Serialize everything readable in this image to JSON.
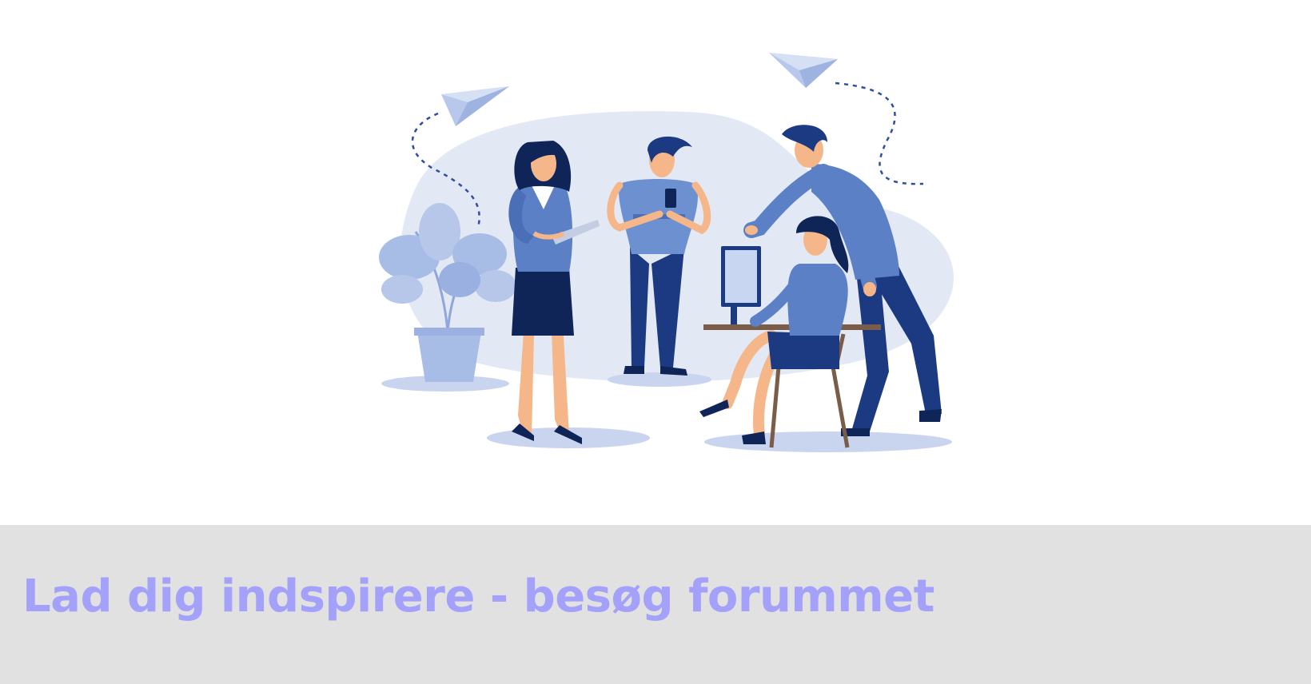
{
  "banner": {
    "link_text": "Lad dig indspirere - besøg forummet"
  },
  "illustration": {
    "icon": "team-office-illustration"
  },
  "colors": {
    "banner_bg": "#e1e1e1",
    "link_text": "#a4a1fb",
    "blob": "#e3e8f5",
    "figure_dark": "#1c3a82",
    "figure_mid": "#5b80c6",
    "figure_light": "#a8bde6",
    "skin": "#f5b78a",
    "navy": "#0f2557"
  }
}
